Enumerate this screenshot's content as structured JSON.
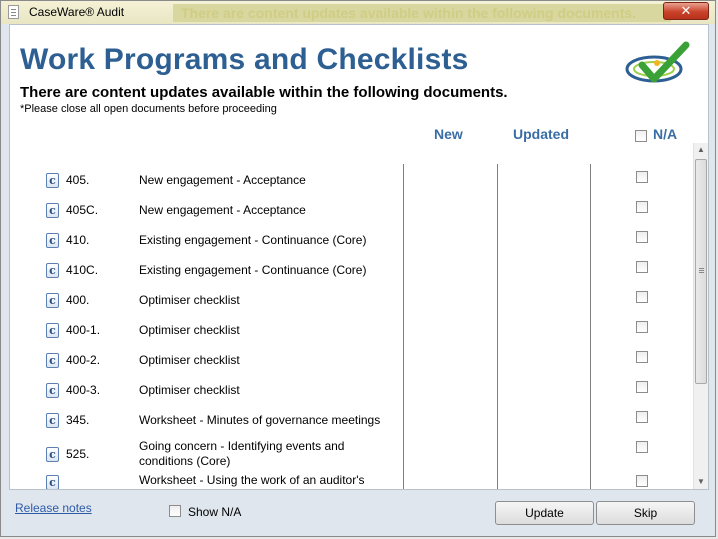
{
  "window": {
    "title": "CaseWare® Audit",
    "background_banner": "There are content updates available within the following documents."
  },
  "header": {
    "title": "Work Programs and Checklists",
    "subtitle": "There are content updates available within the following documents.",
    "note": "*Please close all open documents before proceeding"
  },
  "columns": {
    "new": "New",
    "updated": "Updated",
    "na": "N/A"
  },
  "documents": [
    {
      "code": "405.",
      "description": "New engagement - Acceptance"
    },
    {
      "code": "405C.",
      "description": "New engagement - Acceptance"
    },
    {
      "code": "410.",
      "description": "Existing engagement - Continuance (Core)"
    },
    {
      "code": "410C.",
      "description": "Existing engagement - Continuance (Core)"
    },
    {
      "code": "400.",
      "description": "Optimiser checklist"
    },
    {
      "code": "400-1.",
      "description": "Optimiser checklist"
    },
    {
      "code": "400-2.",
      "description": "Optimiser checklist"
    },
    {
      "code": "400-3.",
      "description": "Optimiser checklist"
    },
    {
      "code": "345.",
      "description": "Worksheet - Minutes of governance meetings"
    },
    {
      "code": "525.",
      "description": "Going concern - Identifying events and conditions (Core)"
    },
    {
      "code": "",
      "description": "Worksheet - Using the work of an auditor's"
    }
  ],
  "footer": {
    "release_notes": "Release notes",
    "show_na": "Show N/A",
    "update_button": "Update",
    "skip_button": "Skip"
  },
  "colors": {
    "title_blue": "#2e5f93",
    "header_blue": "#3a6da5",
    "close_red": "#c9432b",
    "link_blue": "#2f5ba7"
  },
  "icons": {
    "document": "caseware-document-icon",
    "logo": "caseware-checkmark-logo"
  }
}
